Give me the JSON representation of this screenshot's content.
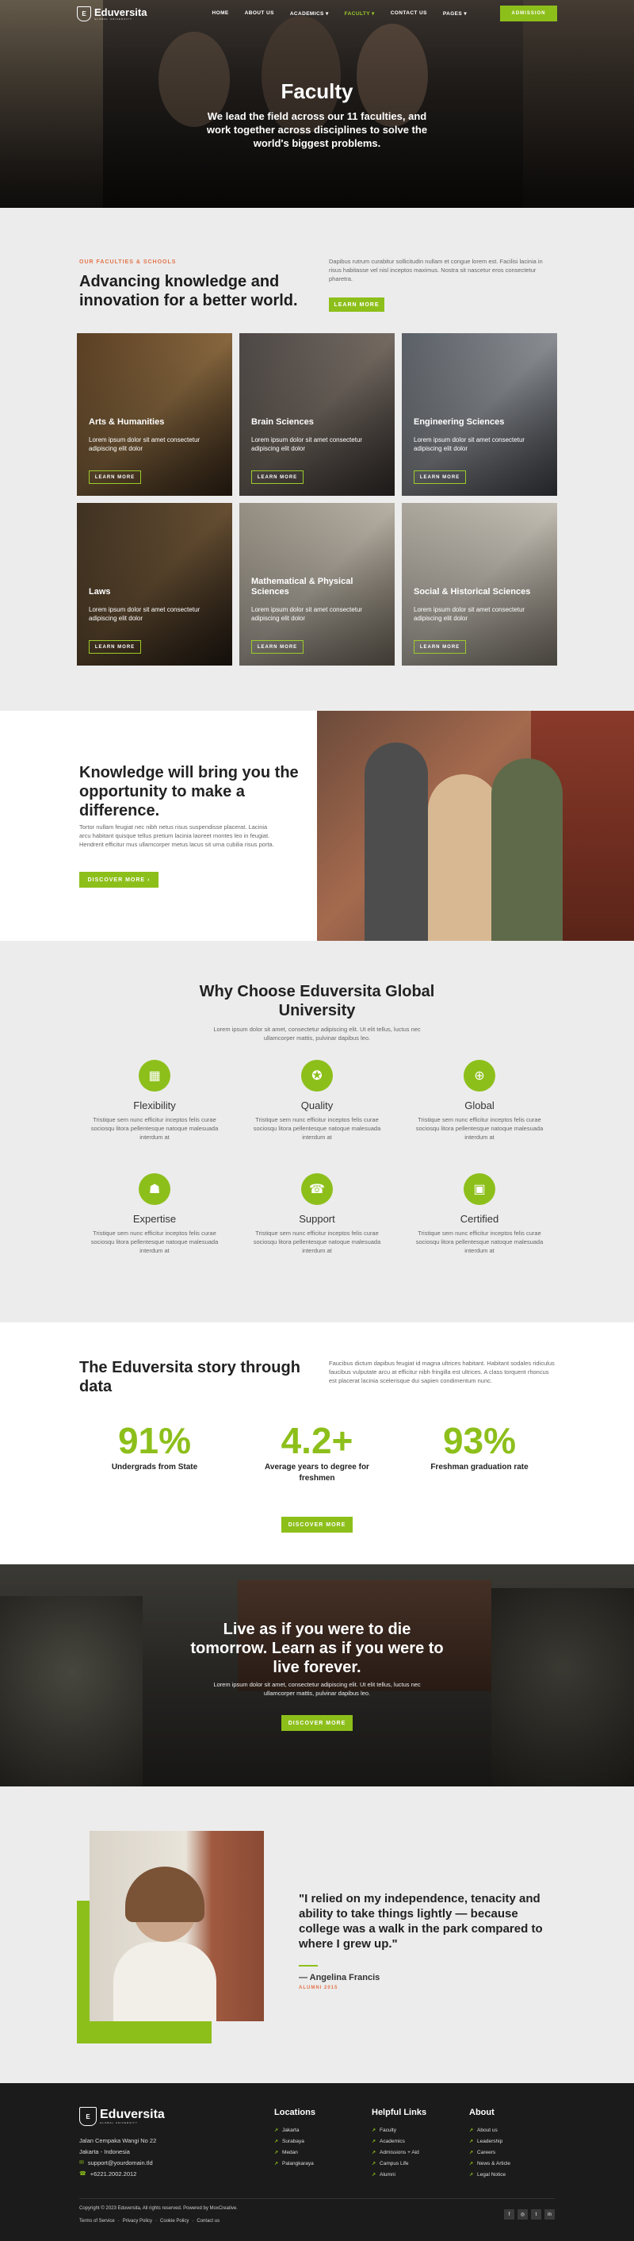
{
  "nav": {
    "logo_text": "Eduversita",
    "logo_tag": "GLOBAL UNIVERSITY",
    "logo_mark": "E",
    "items": [
      {
        "label": "HOME"
      },
      {
        "label": "ABOUT US"
      },
      {
        "label": "ACADEMICS ▾"
      },
      {
        "label": "FACULTY ▾"
      },
      {
        "label": "CONTACT US"
      },
      {
        "label": "PAGES ▾"
      }
    ],
    "admission_label": "ADMISSION"
  },
  "hero": {
    "title": "Faculty",
    "subtitle": "We lead the field across our 11 faculties, and work together across disciplines to solve the world's biggest problems."
  },
  "faculties": {
    "eyebrow": "OUR FACULTIES & SCHOOLS",
    "heading": "Advancing knowledge and innovation for a better world.",
    "text": "Dapibus rutrum curabitur sollicitudin nullam et congue lorem est. Facilisi lacinia in risus habitasse vel nisl inceptos maximus. Nostra sit nascetur eros consectetur pharetra.",
    "learn_more": "LEARN MORE",
    "cards": [
      {
        "title": "Arts & Humanities",
        "text": "Lorem ipsum dolor sit amet consectetur adipiscing elit dolor",
        "cta": "LEARN MORE"
      },
      {
        "title": "Brain Sciences",
        "text": "Lorem ipsum dolor sit amet consectetur adipiscing elit dolor",
        "cta": "LEARN MORE"
      },
      {
        "title": "Engineering Sciences",
        "text": "Lorem ipsum dolor sit amet consectetur adipiscing elit dolor",
        "cta": "LEARN MORE"
      },
      {
        "title": "Laws",
        "text": "Lorem ipsum dolor sit amet consectetur adipiscing elit dolor",
        "cta": "LEARN MORE"
      },
      {
        "title": "Mathematical & Physical Sciences",
        "text": "Lorem ipsum dolor sit amet consectetur adipiscing elit dolor",
        "cta": "LEARN MORE"
      },
      {
        "title": "Social & Historical Sciences",
        "text": "Lorem ipsum dolor sit amet consectetur adipiscing elit dolor",
        "cta": "LEARN MORE"
      }
    ]
  },
  "knowledge": {
    "heading": "Knowledge will bring you the opportunity to make a difference.",
    "text": "Tortor nullam feugiat nec nibh netus risus suspendisse placerat. Lacinia arcu habitant quisque tellus pretium lacinia laoreet montes leo in feugiat. Hendrerit efficitur mus ullamcorper metus lacus sit urna cubilia risus porta.",
    "cta": "DISCOVER MORE  ›"
  },
  "why": {
    "heading": "Why Choose Eduversita Global University",
    "text": "Lorem ipsum dolor sit amet, consectetur adipiscing elit. Ut elit tellus, luctus nec ullamcorper mattis, pulvinar dapibus leo.",
    "features": [
      {
        "title": "Flexibility",
        "icon": "calendar-icon",
        "glyph": "▦",
        "text": "Tristique sem nunc efficitur inceptos felis curae sociosqu litora pellentesque natoque malesuada interdum at"
      },
      {
        "title": "Quality",
        "icon": "award-icon",
        "glyph": "✪",
        "text": "Tristique sem nunc efficitur inceptos felis curae sociosqu litora pellentesque natoque malesuada interdum at"
      },
      {
        "title": "Global",
        "icon": "globe-icon",
        "glyph": "⊕",
        "text": "Tristique sem nunc efficitur inceptos felis curae sociosqu litora pellentesque natoque malesuada interdum at"
      },
      {
        "title": "Expertise",
        "icon": "team-icon",
        "glyph": "☗",
        "text": "Tristique sem nunc efficitur inceptos felis curae sociosqu litora pellentesque natoque malesuada interdum at"
      },
      {
        "title": "Support",
        "icon": "support-icon",
        "glyph": "☎",
        "text": "Tristique sem nunc efficitur inceptos felis curae sociosqu litora pellentesque natoque malesuada interdum at"
      },
      {
        "title": "Certified",
        "icon": "certificate-icon",
        "glyph": "▣",
        "text": "Tristique sem nunc efficitur inceptos felis curae sociosqu litora pellentesque natoque malesuada interdum at"
      }
    ]
  },
  "story": {
    "heading": "The Eduversita story through data",
    "text": "Faucibus dictum dapibus feugiat id magna ultrices habitant. Habitant sodales ridiculus faucibus vulputate arcu at efficitur nibh fringilla est ultrices. A class torquent rhoncus est placerat lacinia scelerisque dui sapien condimentum nunc.",
    "stats": [
      {
        "value": "91%",
        "label": "Undergrads from State"
      },
      {
        "value": "4.2+",
        "label": "Average years to degree for freshmen"
      },
      {
        "value": "93%",
        "label": "Freshman graduation rate"
      }
    ],
    "cta": "DISCOVER MORE"
  },
  "live": {
    "heading": "Live as if you were to die tomorrow. Learn as if you were to live forever.",
    "text": "Lorem ipsum dolor sit amet, consectetur adipiscing elit. Ut elit tellus, luctus nec ullamcorper mattis, pulvinar dapibus leo.",
    "cta": "DISCOVER MORE"
  },
  "testimonial": {
    "quote": "\"I relied on my independence, tenacity and ability to take things lightly — because college was a walk in the park compared to where I grew up.\"",
    "name": "— Angelina Francis",
    "role": "ALUMNI 2015"
  },
  "footer": {
    "logo_text": "Eduversita",
    "logo_tag": "GLOBAL UNIVERSITY",
    "address_1": "Jalan Cempaka Wangi No 22",
    "address_2": "Jakarta - Indonesia",
    "email": "support@yourdomain.tld",
    "phone": "+6221.2002.2012",
    "columns": [
      {
        "title": "Locations",
        "items": [
          "Jakarta",
          "Surabaya",
          "Medan",
          "Palangkaraya"
        ]
      },
      {
        "title": "Helpful Links",
        "items": [
          "Faculty",
          "Academics",
          "Admissions + Aid",
          "Campus Life",
          "Alumni"
        ]
      },
      {
        "title": "About",
        "items": [
          "About us",
          "Leadership",
          "Careers",
          "News & Article",
          "Legal Notice"
        ]
      }
    ],
    "copyright": "Copyright © 2023 Eduversita, All rights reserved. Powered by MoxCreative.",
    "legal_links": [
      "Terms of Service",
      "·",
      "Privacy Policy",
      "·",
      "Cookie Policy",
      "·",
      "Contact us"
    ],
    "social": [
      {
        "icon": "facebook-icon",
        "glyph": "f"
      },
      {
        "icon": "instagram-icon",
        "glyph": "◎"
      },
      {
        "icon": "twitter-icon",
        "glyph": "t"
      },
      {
        "icon": "linkedin-icon",
        "glyph": "in"
      }
    ]
  },
  "colors": {
    "accent": "#8dbf1b",
    "eyebrow": "#e2754a",
    "footer_bg": "#1b1b1b",
    "section_bg": "#ececec"
  }
}
